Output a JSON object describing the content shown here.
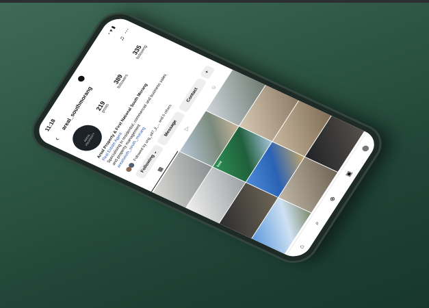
{
  "status_bar": {
    "time": "11:18",
    "icons": "◔ ▾ ▮"
  },
  "profile": {
    "username": "areal_southmorang",
    "avatar_text": "AREAL PROPERTY",
    "stats": [
      {
        "value": "219",
        "label": "posts"
      },
      {
        "value": "389",
        "label": "followers"
      },
      {
        "value": "335",
        "label": "following"
      }
    ],
    "bio_lines": [
      "Areal Property & First National South Morang",
      "Real Estate Agent",
      "Specialising in residential, commercial and business sales",
      "and property management",
      "arealsouth_south_morang"
    ],
    "followed_by": "Followed by ang_a87_jl_... and 6 others",
    "buttons": {
      "following": "Following ⌄",
      "message": "Message",
      "contact": "Contact"
    }
  },
  "grid_tag": "Sold",
  "colors": {
    "background": "#2c5444",
    "phone": "#1d2a25",
    "link": "#2a5cb0"
  }
}
